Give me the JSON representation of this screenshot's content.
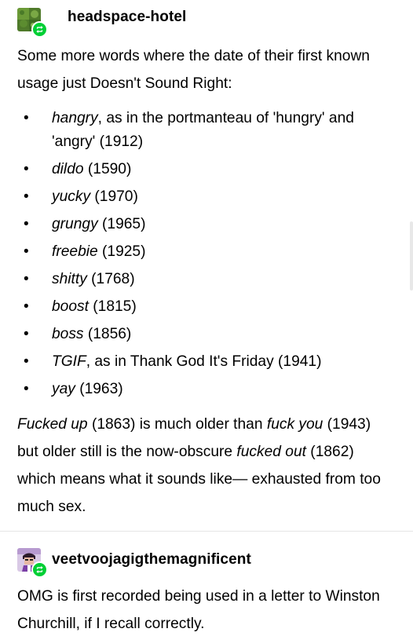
{
  "post1": {
    "username": "headspace-hotel",
    "intro": "Some more words where the date of their first known usage just Doesn't Sound Right:",
    "items": [
      {
        "word": "hangry",
        "rest": ", as in the portmanteau of 'hungry' and 'angry' (1912)"
      },
      {
        "word": "dildo",
        "rest": " (1590)"
      },
      {
        "word": "yucky",
        "rest": " (1970)"
      },
      {
        "word": "grungy",
        "rest": " (1965)"
      },
      {
        "word": "freebie",
        "rest": " (1925)"
      },
      {
        "word": "shitty",
        "rest": " (1768)"
      },
      {
        "word": "boost",
        "rest": " (1815)"
      },
      {
        "word": "boss",
        "rest": " (1856)"
      },
      {
        "word": "TGIF",
        "rest": ", as in Thank God It's Friday (1941)"
      },
      {
        "word": "yay",
        "rest": " (1963)"
      }
    ],
    "closing": {
      "w1": "Fucked up",
      "t1": " (1863) is much older than ",
      "w2": "fuck you",
      "t2": " (1943) but older still is the now-obscure ",
      "w3": "fucked out",
      "t3": " (1862) which means what it sounds like— exhausted from too much sex."
    }
  },
  "post2": {
    "username": "veetvoojagigthemagnificent",
    "text": "OMG is first recorded being used in a letter to Winston Churchill, if I recall correctly."
  },
  "colors": {
    "reblog_badge": "#00cf35",
    "divider": "#e5e5e5"
  },
  "icons": {
    "reblog": "reblog-icon",
    "avatar1": "avatar-grass",
    "avatar2": "avatar-character"
  }
}
